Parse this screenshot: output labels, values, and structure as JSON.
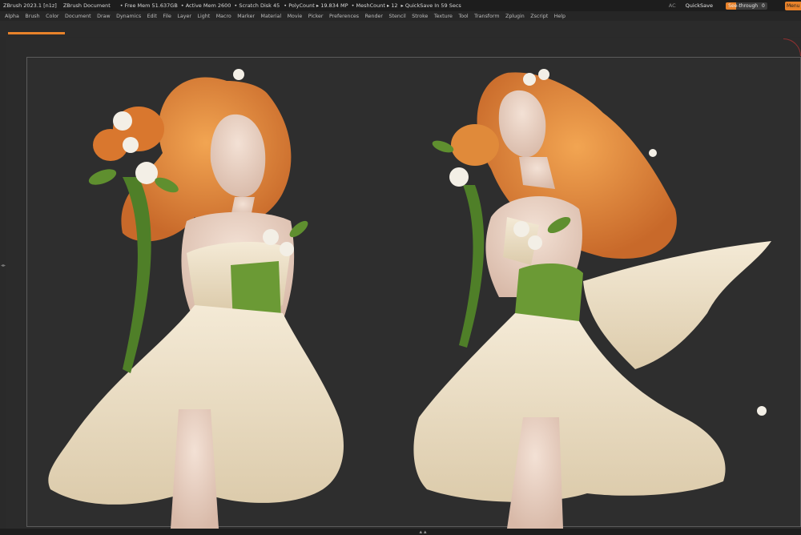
{
  "titlebar": {
    "app": "ZBrush 2023.1 [n1z]",
    "document": "ZBrush Document",
    "free_mem": "• Free Mem 51.637GB",
    "active_mem": "• Active Mem 2600",
    "scratch_disk": "• Scratch Disk 45",
    "poly_count": "• PolyCount ▸ 19.834 MP",
    "mesh_count": "• MeshCount ▸ 12",
    "quicksave_timer": "▸ QuickSave In 59 Secs",
    "ac": "AC",
    "quicksave": "QuickSave",
    "see_through_label": "See-through",
    "see_through_value": "0",
    "see_through_level": 0.25,
    "menus": "Menu"
  },
  "menubar": {
    "items": [
      "Alpha",
      "Brush",
      "Color",
      "Document",
      "Draw",
      "Dynamics",
      "Edit",
      "File",
      "Layer",
      "Light",
      "Macro",
      "Marker",
      "Material",
      "Movie",
      "Picker",
      "Preferences",
      "Render",
      "Stencil",
      "Stroke",
      "Texture",
      "Tool",
      "Transform",
      "Zplugin",
      "Zscript",
      "Help"
    ]
  },
  "colors": {
    "accent": "#e8822a",
    "background": "#2a2a2a",
    "hair": "#e08a3a",
    "dress": "#ece0c6",
    "sash": "#6b9a35",
    "skin": "#e9d2c3"
  }
}
